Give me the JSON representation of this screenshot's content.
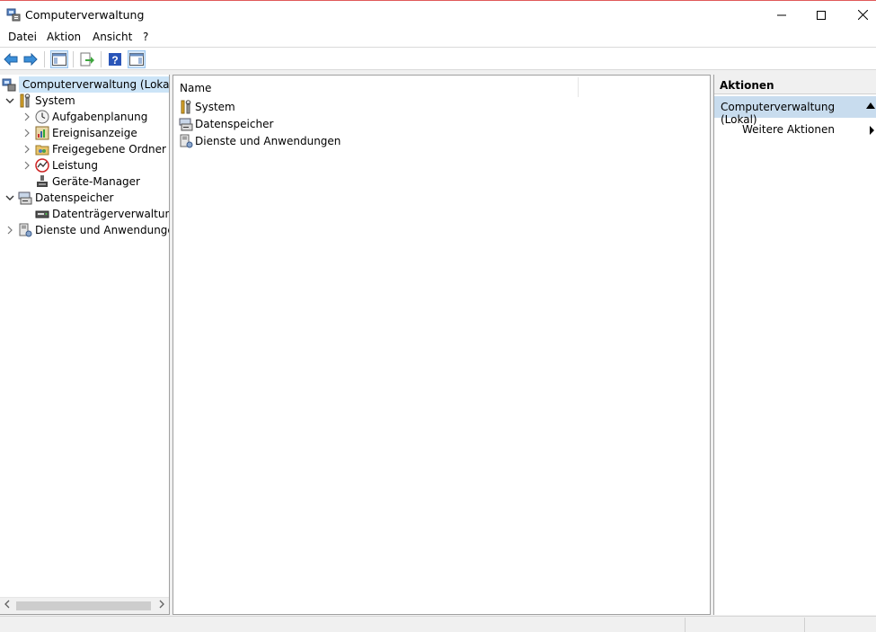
{
  "window": {
    "title": "Computerverwaltung"
  },
  "menu": [
    "Datei",
    "Aktion",
    "Ansicht",
    "?"
  ],
  "toolbar": {
    "buttons": [
      "back-arrow-icon",
      "forward-arrow-icon",
      "show-hide-tree-icon",
      "export-list-icon",
      "help-icon",
      "show-hide-action-pane-icon"
    ]
  },
  "tree": {
    "root": "Computerverwaltung (Lokal)",
    "system": "System",
    "aufgaben": "Aufgabenplanung",
    "ereignis": "Ereignisanzeige",
    "freigegeben": "Freigegebene Ordner",
    "leistung": "Leistung",
    "geraete": "Geräte-Manager",
    "datenspeicher": "Datenspeicher",
    "datentraeger": "Datenträgerverwaltung",
    "dienste": "Dienste und Anwendungen"
  },
  "content": {
    "column": "Name",
    "items": [
      "System",
      "Datenspeicher",
      "Dienste und Anwendungen"
    ]
  },
  "actions": {
    "header": "Aktionen",
    "section": "Computerverwaltung (Lokal)",
    "item": "Weitere Aktionen"
  }
}
